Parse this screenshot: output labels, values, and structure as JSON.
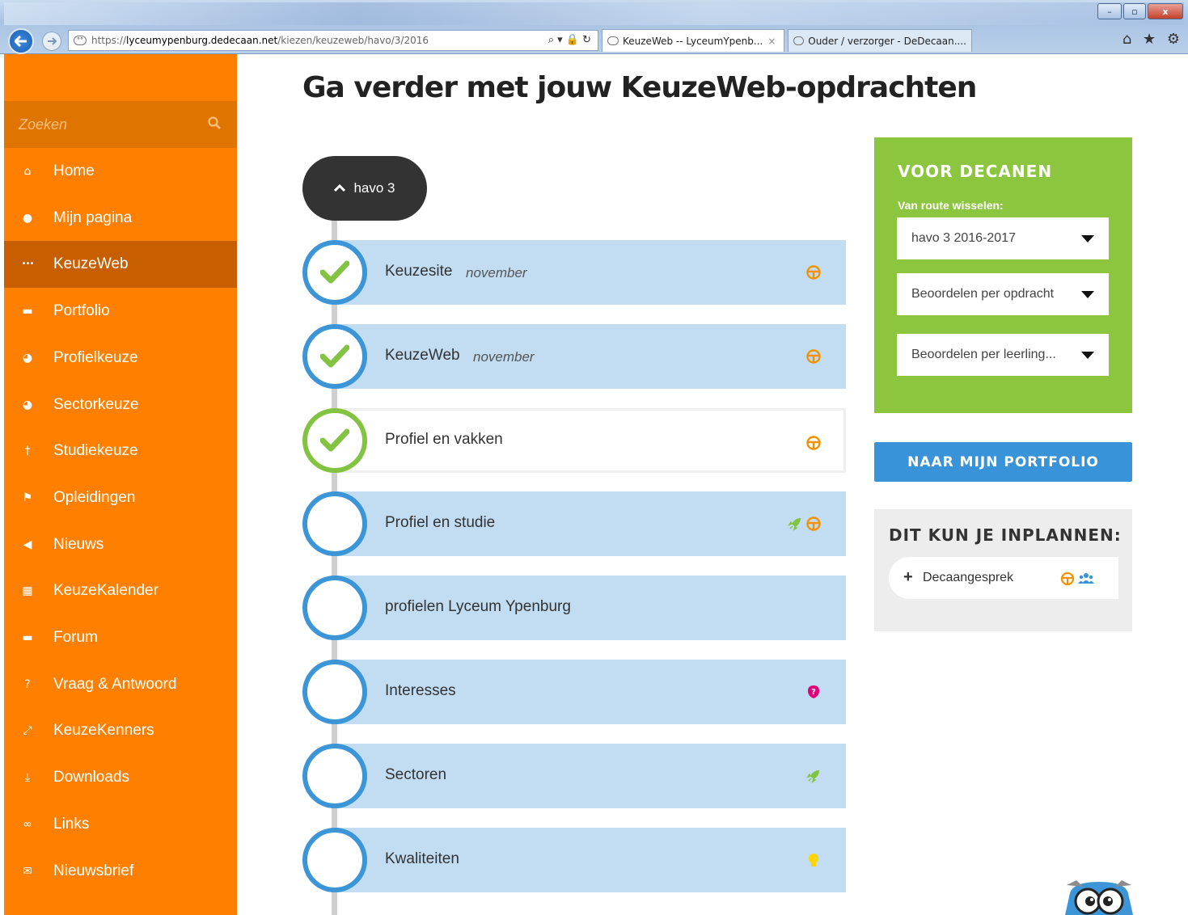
{
  "browser": {
    "url_prefix": "https://",
    "url_host": "lyceumypenburg.dedecaan.net",
    "url_path": "/kiezen/keuzeweb/havo/3/2016",
    "address_controls": "⌕ ▾ 🔒 ↻",
    "tabs": [
      {
        "title": "KeuzeWeb -- LyceumYpenb...",
        "close": "×"
      },
      {
        "title": "Ouder / verzorger - DeDecaan...."
      }
    ],
    "window_buttons": [
      "–",
      "▫",
      "x"
    ],
    "toolbar_icons": "⌂ ★ ⚙"
  },
  "sidebar": {
    "search_placeholder": "Zoeken",
    "items": [
      {
        "label": "Home",
        "icon": "home-icon",
        "glyph": "⌂"
      },
      {
        "label": "Mijn pagina",
        "icon": "user-icon",
        "glyph": "●"
      },
      {
        "label": "KeuzeWeb",
        "icon": "ellipsis-icon",
        "glyph": "•••"
      },
      {
        "label": "Portfolio",
        "icon": "briefcase-icon",
        "glyph": "▬"
      },
      {
        "label": "Profielkeuze",
        "icon": "pie-icon",
        "glyph": "◕"
      },
      {
        "label": "Sectorkeuze",
        "icon": "pie-icon",
        "glyph": "◕"
      },
      {
        "label": "Studiekeuze",
        "icon": "signpost-icon",
        "glyph": "†"
      },
      {
        "label": "Opleidingen",
        "icon": "flag-icon",
        "glyph": "⚑"
      },
      {
        "label": "Nieuws",
        "icon": "megaphone-icon",
        "glyph": "◀"
      },
      {
        "label": "KeuzeKalender",
        "icon": "calendar-icon",
        "glyph": "▦"
      },
      {
        "label": "Forum",
        "icon": "chat-icon",
        "glyph": "▬"
      },
      {
        "label": "Vraag & Antwoord",
        "icon": "question-icon",
        "glyph": "?"
      },
      {
        "label": "KeuzeKenners",
        "icon": "expand-icon",
        "glyph": "⤢"
      },
      {
        "label": "Downloads",
        "icon": "download-icon",
        "glyph": "⤓"
      },
      {
        "label": "Links",
        "icon": "link-icon",
        "glyph": "∞"
      },
      {
        "label": "Nieuwsbrief",
        "icon": "envelope-icon",
        "glyph": "✉"
      }
    ],
    "active_index": 2
  },
  "main": {
    "title": "Ga verder met jouw KeuzeWeb-opdrachten",
    "route_label": "havo 3",
    "tasks": [
      {
        "label": "Keuzesite",
        "month": "november",
        "status": "done",
        "icons": [
          "wheel-icon"
        ]
      },
      {
        "label": "KeuzeWeb",
        "month": "november",
        "status": "done",
        "icons": [
          "wheel-icon"
        ]
      },
      {
        "label": "Profiel en vakken",
        "month": "",
        "status": "done-open",
        "icons": [
          "wheel-icon"
        ]
      },
      {
        "label": "Profiel en studie",
        "month": "",
        "status": "todo",
        "icons": [
          "rocket-icon",
          "wheel-icon"
        ]
      },
      {
        "label": "profielen Lyceum Ypenburg",
        "month": "",
        "status": "todo",
        "icons": []
      },
      {
        "label": "Interesses",
        "month": "",
        "status": "todo",
        "icons": [
          "question-bubble-icon"
        ]
      },
      {
        "label": "Sectoren",
        "month": "",
        "status": "todo",
        "icons": [
          "rocket-icon"
        ]
      },
      {
        "label": "Kwaliteiten",
        "month": "",
        "status": "todo",
        "icons": [
          "bulb-icon"
        ]
      }
    ]
  },
  "decanen": {
    "title": "VOOR DECANEN",
    "subtitle": "Van route wisselen:",
    "selects": [
      {
        "value": "havo 3 2016-2017"
      },
      {
        "value": "Beoordelen per opdracht"
      },
      {
        "value": "Beoordelen per leerling..."
      }
    ]
  },
  "portfolio_button": "NAAR MIJN PORTFOLIO",
  "plan": {
    "title": "DIT KUN JE INPLANNEN:",
    "item": "Decaangesprek",
    "icons": [
      "wheel-icon",
      "group-icon"
    ]
  },
  "colors": {
    "sidebar": "#ff8000",
    "sidebar_active": "#c75f00",
    "task_bg": "#c2dcf2",
    "circle_blue": "#3c95d6",
    "check_green": "#82c341",
    "decanen_green": "#8cc63f",
    "button_blue": "#3893d8",
    "icon_orange": "#f39200",
    "icon_pink": "#e2007a",
    "icon_yellow": "#ffd400"
  }
}
